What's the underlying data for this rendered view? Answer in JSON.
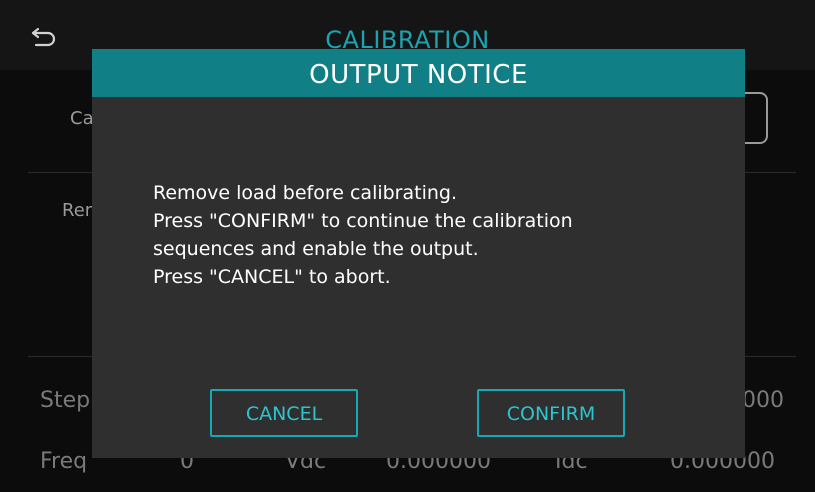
{
  "background": {
    "title": "CALIBRATION",
    "calib_label": "Ca",
    "remove_label": "Rem",
    "step_label": "Step",
    "step_value": "000",
    "freq_label": "Freq",
    "freq_value": "0",
    "vdc_label": "Vdc",
    "vdc_value": "0.000000",
    "idc_label": "Idc",
    "idc_value": "0.000000"
  },
  "dialog": {
    "title": "OUTPUT NOTICE",
    "lines": [
      "Remove load before calibrating.",
      "Press \"CONFIRM\" to continue the calibration",
      "sequences and enable the output.",
      "Press \"CANCEL\" to abort."
    ],
    "cancel_label": "CANCEL",
    "confirm_label": "CONFIRM"
  },
  "icons": {
    "back": "back-arrow-icon"
  },
  "colors": {
    "accent": "#117f86",
    "button_text": "#2cc4cd",
    "title_text": "#1aa3b0"
  }
}
